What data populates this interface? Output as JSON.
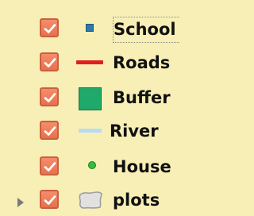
{
  "layers": [
    {
      "name": "School",
      "checked": true,
      "symbol": "square-point",
      "color": "#2f79a8",
      "expandable": false
    },
    {
      "name": "Roads",
      "checked": true,
      "symbol": "line",
      "color": "#e11e1e",
      "expandable": false
    },
    {
      "name": "Buffer",
      "checked": true,
      "symbol": "polygon",
      "color": "#1fa96a",
      "expandable": false
    },
    {
      "name": "River",
      "checked": true,
      "symbol": "line",
      "color": "#b9dbf2",
      "expandable": false
    },
    {
      "name": "House",
      "checked": true,
      "symbol": "circle-point",
      "color": "#38bb3d",
      "expandable": false
    },
    {
      "name": "plots",
      "checked": true,
      "symbol": "polygon-outline",
      "color": "#d9d9d9",
      "expandable": true
    }
  ],
  "colors": {
    "background": "#f7efb6",
    "checkbox": "#ee7b57",
    "checkmark": "#ffffff"
  }
}
